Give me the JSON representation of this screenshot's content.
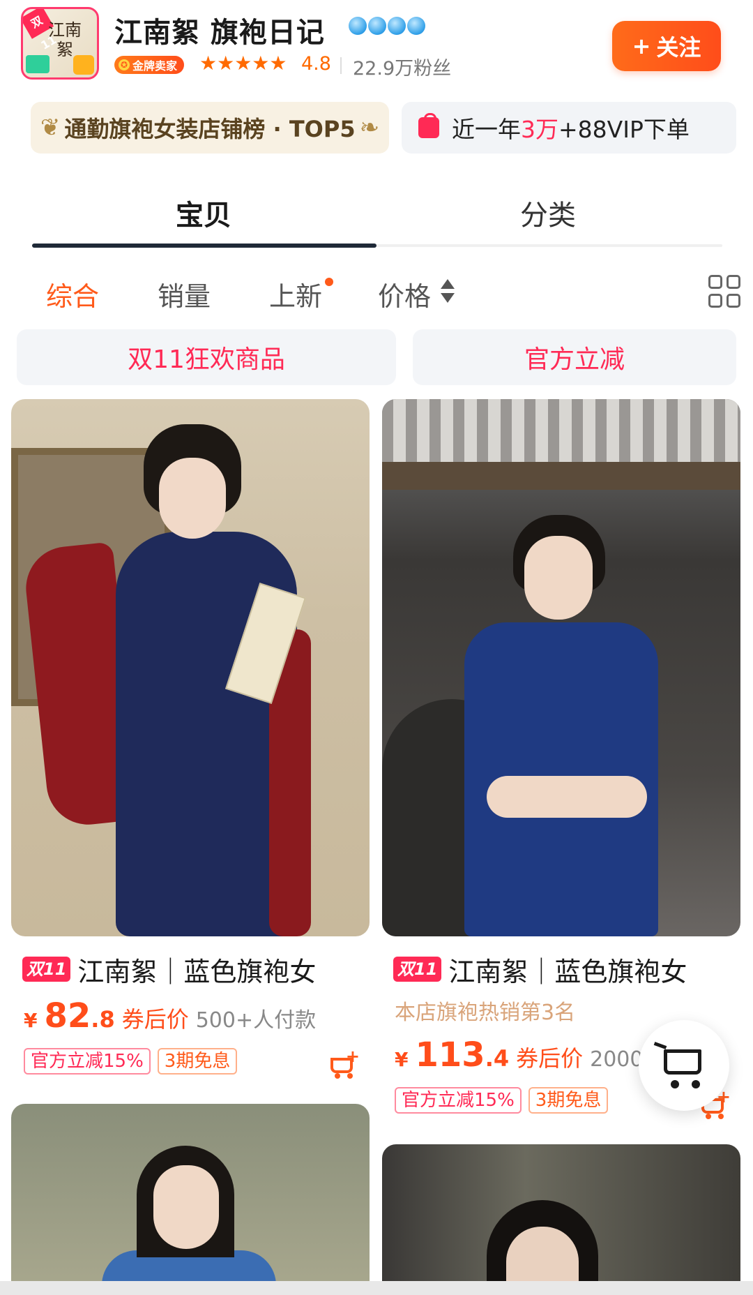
{
  "shop": {
    "logo_text": "江南絮",
    "logo_tag": "双11",
    "name": "江南絮  旗袍日记",
    "gold_badge": "金牌卖家",
    "stars": "★★★★★",
    "rating": "4.8",
    "fans": "22.9万粉丝",
    "follow_label": "关注",
    "follow_icon": "+"
  },
  "badges": {
    "rank": "通勤旗袍女装店铺榜 · TOP5",
    "vip_prefix": "近一年",
    "vip_highlight": "3万",
    "vip_suffix": "+88VIP下单"
  },
  "tabs": [
    {
      "label": "宝贝",
      "active": true
    },
    {
      "label": "分类",
      "active": false
    }
  ],
  "sort": {
    "zonghe": "综合",
    "xiaoliang": "销量",
    "shangxin": "上新",
    "price": "价格"
  },
  "promos": {
    "left": "双11狂欢商品",
    "right": "官方立减"
  },
  "products": [
    {
      "tag": "双11",
      "title": "江南絮｜蓝色旗袍女",
      "price_symbol": "¥",
      "price_int": "82",
      "price_dec": ".8",
      "price_label": "券后价",
      "sold": "500+人付款",
      "tags": [
        "官方立减15%",
        "3期免息"
      ]
    },
    {
      "tag": "双11",
      "title": "江南絮｜蓝色旗袍女",
      "hot_note": "本店旗袍热销第3名",
      "price_symbol": "¥",
      "price_int": "113",
      "price_dec": ".4",
      "price_label": "券后价",
      "sold": "2000-",
      "tags": [
        "官方立减15%",
        "3期免息"
      ]
    }
  ],
  "colors": {
    "accent": "#ff5a1a",
    "brand_red": "#ff2a55",
    "tab_active": "#1f2937"
  }
}
